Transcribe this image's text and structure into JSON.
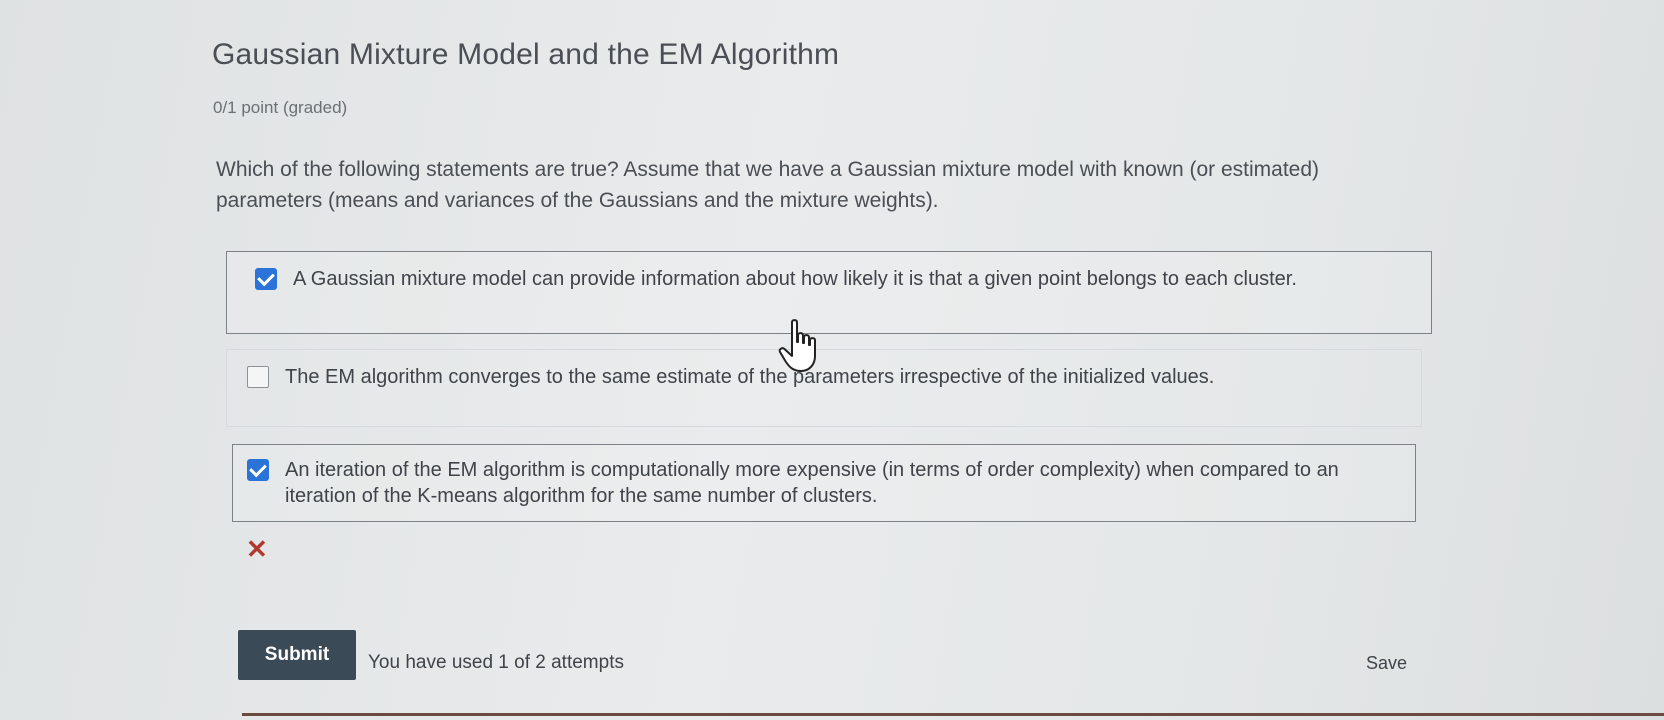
{
  "problem": {
    "title": "Gaussian Mixture Model and the EM Algorithm",
    "points": "0/1 point (graded)",
    "question": "Which of the following statements are true? Assume that we have a Gaussian mixture model with known (or estimated) parameters (means and variances of the Gaussians and the mixture weights)."
  },
  "choices": [
    {
      "text": "A Gaussian mixture model can provide information about how likely it is that a given point belongs to each cluster.",
      "checked": true
    },
    {
      "text": "The EM algorithm converges to the same estimate of the parameters irrespective of the initialized values.",
      "checked": false
    },
    {
      "text": "An iteration of the EM algorithm is computationally more expensive (in terms of order complexity) when compared to an iteration of the K-means algorithm for the same number of clusters.",
      "checked": true
    }
  ],
  "feedback": {
    "icon": "incorrect-x-icon",
    "color": "#b03a2e"
  },
  "actions": {
    "submit_label": "Submit",
    "attempts_text": "You have used 1 of 2 attempts",
    "save_label": "Save"
  },
  "colors": {
    "checkbox_checked": "#2a73d9",
    "submit_background": "#3b4a57"
  }
}
